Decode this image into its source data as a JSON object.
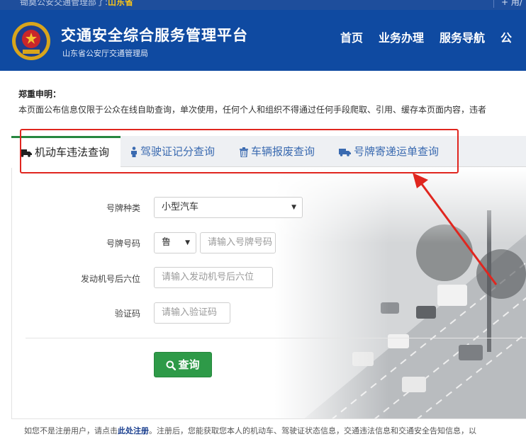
{
  "topbar": {
    "left_prefix": "锄奠公安交通管理部了:",
    "left_province": "山东省",
    "right_text": "+ 用/"
  },
  "header": {
    "title": "交通安全综合服务管理平台",
    "subtitle": "山东省公安厅交通管理局",
    "nav": [
      "首页",
      "业务办理",
      "服务导航",
      "公"
    ]
  },
  "statement": {
    "title": "郑重申明：",
    "text": "本页面公布信息仅限于公众在线自助查询，单次使用，任何个人和组织不得通过任何手段爬取、引用、缓存本页面内容，违者"
  },
  "tabs": [
    {
      "label": "机动车违法查询",
      "icon": "truck-icon",
      "active": true
    },
    {
      "label": "驾驶证记分查询",
      "icon": "person-icon",
      "active": false
    },
    {
      "label": "车辆报废查询",
      "icon": "trash-icon",
      "active": false
    },
    {
      "label": "号牌寄递运单查询",
      "icon": "truck-icon",
      "active": false
    }
  ],
  "form": {
    "plate_type_label": "号牌种类",
    "plate_type_value": "小型汽车",
    "plate_number_label": "号牌号码",
    "plate_prefix_value": "鲁",
    "plate_number_placeholder": "请输入号牌号码",
    "engine_label": "发动机号后六位",
    "engine_placeholder": "请输入发动机号后六位",
    "captcha_label": "验证码",
    "captcha_placeholder": "请输入验证码",
    "query_button": "查询"
  },
  "footer": {
    "prefix": "如您不是注册用户，请点击",
    "link": "此处注册",
    "suffix": "。注册后，您能获取您本人的机动车、驾驶证状态信息，交通违法信息和交通安全告知信息，以"
  },
  "colors": {
    "header_bg": "#0f4aa1",
    "tab_link": "#3a6ab0",
    "active_tab_border": "#27873f",
    "query_button": "#2e9a48",
    "annotation_red": "#e0261f"
  }
}
